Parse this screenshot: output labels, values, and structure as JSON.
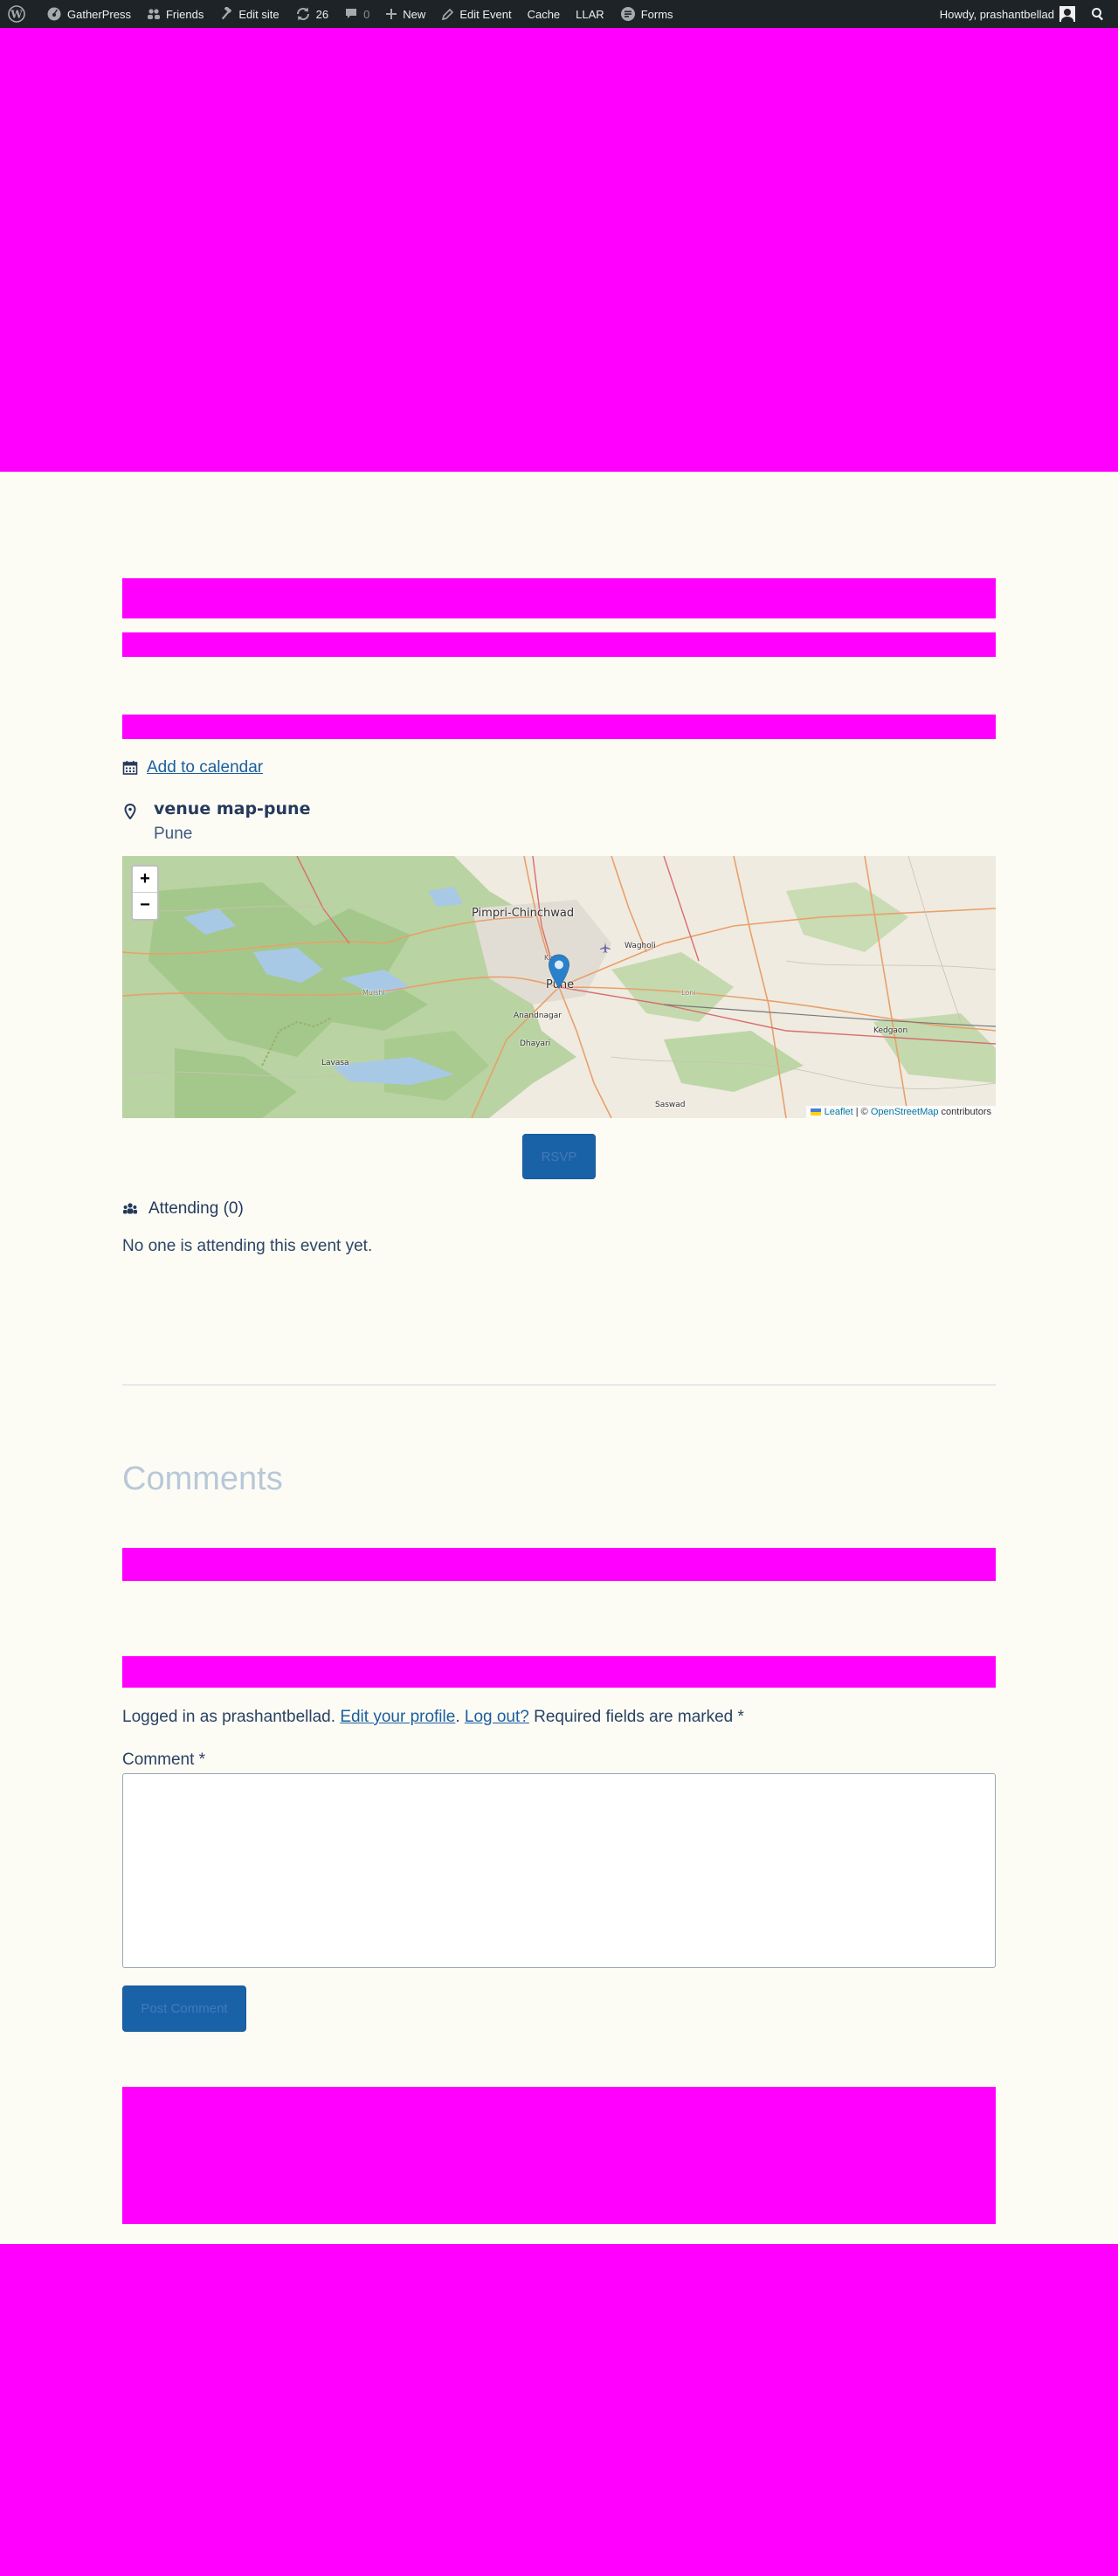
{
  "adminbar": {
    "site_name": "GatherPress",
    "friends": "Friends",
    "edit_site": "Edit site",
    "updates_count": "26",
    "comments_count": "0",
    "new_label": "New",
    "edit_event": "Edit Event",
    "cache": "Cache",
    "llar": "LLAR",
    "forms": "Forms",
    "howdy": "Howdy, prashantbellad"
  },
  "event": {
    "add_to_calendar": "Add to calendar",
    "venue_name": "venue map-pune",
    "venue_city": "Pune",
    "rsvp_label": "RSVP",
    "attending_label": "Attending (0)",
    "no_attendees": "No one is attending this event yet."
  },
  "map": {
    "zoom_in": "+",
    "zoom_out": "−",
    "attribution_leaflet": "Leaflet",
    "attribution_sep": " | © ",
    "attribution_osm": "OpenStreetMap",
    "attribution_suffix": " contributors",
    "labels": {
      "pimpri": "Pimpri-Chinchwad",
      "pune": "Pune",
      "wagholi": "Wagholi",
      "anandnagar": "Anandnagar",
      "dhayari": "Dhayari",
      "lavasa": "Lavasa",
      "saswad": "Saswad",
      "kedgaon": "Kedgaon",
      "mulshi": "Mulshi",
      "loni": "Loni",
      "kirkee": "Kirkee"
    }
  },
  "comments": {
    "title": "Comments",
    "logged_in_prefix": "Logged in as prashantbellad. ",
    "edit_profile": "Edit your profile",
    "separator": ". ",
    "log_out": "Log out?",
    "required_note": " Required fields are marked *",
    "comment_label": "Comment *",
    "post_button": "Post Comment"
  },
  "colors": {
    "placeholder": "#ff00ff",
    "accent": "#1a62a8",
    "link": "#1b5e9e",
    "background": "#fcfcf5"
  }
}
